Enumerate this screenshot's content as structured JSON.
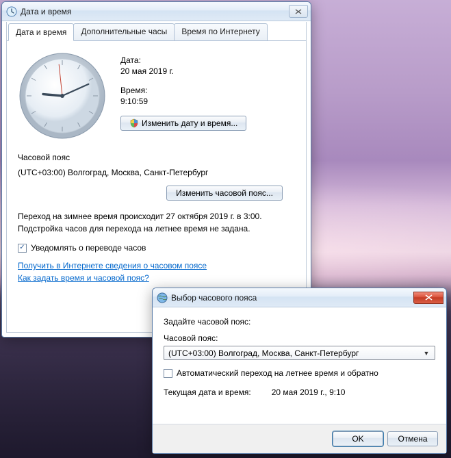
{
  "main": {
    "title": "Дата и время",
    "tabs": {
      "datetime": "Дата и время",
      "additional": "Дополнительные часы",
      "internet": "Время по Интернету"
    },
    "date_label": "Дата:",
    "date_value": "20 мая 2019 г.",
    "time_label": "Время:",
    "time_value": "9:10:59",
    "change_datetime_btn": "Изменить дату и время...",
    "tz_header": "Часовой пояс",
    "tz_value": "(UTC+03:00) Волгоград, Москва, Санкт-Петербург",
    "change_tz_btn": "Изменить часовой пояс...",
    "dst_line1": "Переход на зимнее время происходит 27 октября 2019 г. в 3:00.",
    "dst_line2": "Подстройка часов для перехода на летнее время не задана.",
    "notify_checkbox": "Уведомлять о переводе часов",
    "notify_checked": true,
    "link_info": "Получить в Интернете сведения о часовом поясе",
    "link_howto": "Как задать время и часовой пояс?",
    "clock": {
      "hour": 9,
      "minute": 10,
      "second": 59
    }
  },
  "tz_dialog": {
    "title": "Выбор часового пояса",
    "instruction": "Задайте часовой пояс:",
    "combo_label": "Часовой пояс:",
    "combo_value": "(UTC+03:00) Волгоград, Москва, Санкт-Петербург",
    "auto_dst": "Автоматический переход на летнее время и обратно",
    "auto_dst_checked": false,
    "current_label": "Текущая дата и время:",
    "current_value": "20 мая 2019 г., 9:10",
    "ok_btn": "OK",
    "cancel_btn": "Отмена"
  }
}
